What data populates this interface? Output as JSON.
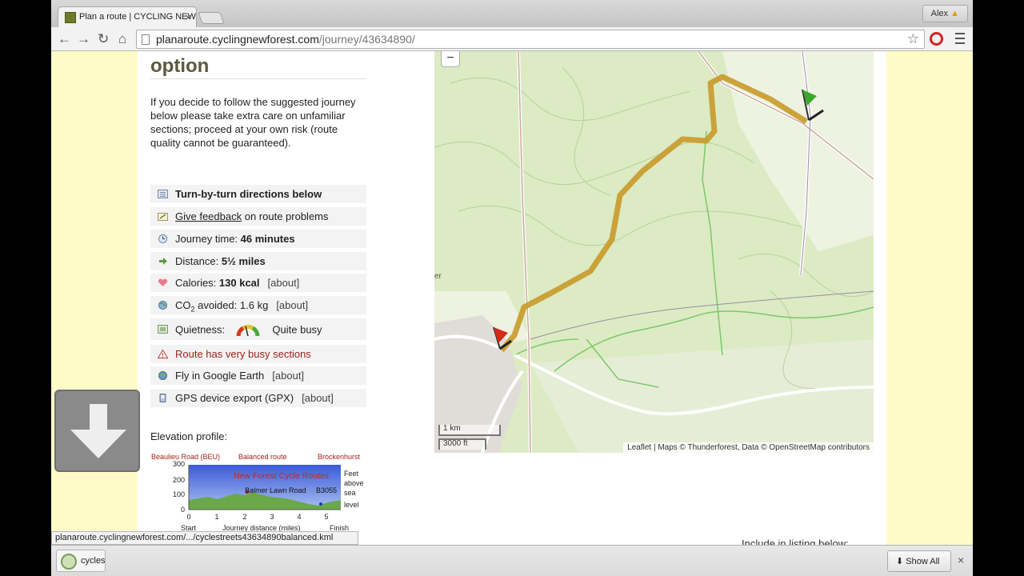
{
  "browser": {
    "tab_title": "Plan a route | CYCLING NEW",
    "tab_close": "×",
    "user_name": "Alex",
    "url_host": "planaroute.cyclingnewforest.com",
    "url_path": "/journey/43634890/",
    "nav_back": "←",
    "nav_forward": "→",
    "nav_reload": "↻",
    "nav_home": "⌂",
    "bookmark_star": "☆"
  },
  "page": {
    "heading": "option",
    "intro": "If you decide to follow the suggested journey below please take extra care on unfamiliar sections; proceed at your own risk (route quality cannot be guaranteed).",
    "rows": {
      "directions": "Turn-by-turn directions below",
      "feedback_link": "Give feedback",
      "feedback_rest": " on route problems",
      "journey_label": "Journey time: ",
      "journey_value": "46 minutes",
      "distance_label": "Distance: ",
      "distance_value": "5½ miles",
      "calories_label": "Calories: ",
      "calories_value": "130 kcal",
      "co2_label": "CO",
      "co2_sub": "2",
      "co2_rest": " avoided: 1.6 kg",
      "quietness_label": "Quietness:",
      "quietness_value": "Quite busy",
      "busy_warning": "Route has very busy sections",
      "google_earth": "Fly in Google Earth",
      "gpx": "GPS device export (GPX)",
      "about": "[about]"
    },
    "elevation": {
      "title": "Elevation profile:",
      "start_place": "Beaulieu Road (BEU)",
      "route_type": "Balanced route",
      "end_place": "Brockenhurst",
      "overlay_title": "New Forest Cycle Routes",
      "road_label": "Balmer Lawn Road",
      "b_road": "B3055",
      "y_ticks": [
        "300",
        "200",
        "100",
        "0"
      ],
      "x_ticks": [
        "0",
        "1",
        "2",
        "3",
        "4",
        "5"
      ],
      "unit_lines": [
        "Feet",
        "above",
        "sea",
        "level"
      ],
      "x_start": "Start",
      "x_label": "Journey distance (miles)",
      "x_finish": "Finish"
    },
    "map": {
      "zoom_out": "−",
      "scale_km": "1 km",
      "scale_ft": "3000 ft",
      "attribution": "Leaflet | Maps © Thunderforest, Data © OpenStreetMap contributors",
      "edge_text": "er"
    },
    "listing_text": "Include in listing below:"
  },
  "status_bar": "planaroute.cyclingnewforest.com/.../cyclestreets43634890balanced.kml",
  "download_shelf": {
    "item_name": "cycles",
    "show_all": "Show All",
    "close": "×",
    "download_icon": "download-arrow-icon"
  }
}
